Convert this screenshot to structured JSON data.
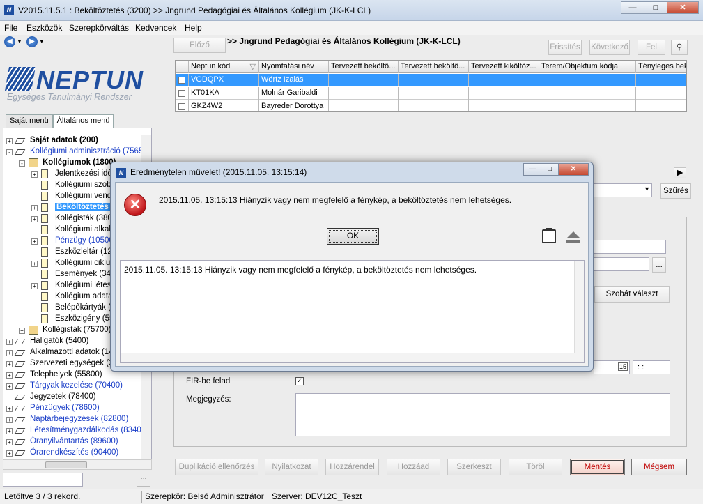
{
  "window": {
    "title": "V2015.11.5.1 : Beköltöztetés (3200)  >> Jngrund Pedagógiai és Általános Kollégium (JK-K-LCL)",
    "app_icon": "N"
  },
  "menu": [
    "File",
    "Eszközök",
    "Szerepkörváltás",
    "Kedvencek",
    "Help"
  ],
  "logo": {
    "name": "NEPTUN",
    "subtitle": "Egységes Tanulmányi Rendszer"
  },
  "sidebar_tabs": [
    "Saját menü",
    "Általános menü"
  ],
  "tree": [
    {
      "label": "Saját adatok (200)",
      "indent": 0,
      "icon": "diamond",
      "style": "bold",
      "exp": "+"
    },
    {
      "label": "Kollégiumi adminisztráció (75650)",
      "indent": 0,
      "icon": "diamond",
      "style": "blue",
      "exp": "-"
    },
    {
      "label": "Kollégiumok (1800)",
      "indent": 1,
      "icon": "house",
      "style": "bold",
      "exp": "-"
    },
    {
      "label": "Jelentkezési idő",
      "indent": 2,
      "icon": "doc",
      "style": "",
      "exp": "+"
    },
    {
      "label": "Kollégiumi szoba",
      "indent": 2,
      "icon": "doc",
      "style": "",
      "exp": ""
    },
    {
      "label": "Kollégiumi vendé",
      "indent": 2,
      "icon": "doc",
      "style": "",
      "exp": ""
    },
    {
      "label": "Beköltöztetés",
      "indent": 2,
      "icon": "doc",
      "style": "sel",
      "exp": "+"
    },
    {
      "label": "Kollégisták (380",
      "indent": 2,
      "icon": "doc",
      "style": "",
      "exp": "+"
    },
    {
      "label": "Kollégiumi alkalm",
      "indent": 2,
      "icon": "doc",
      "style": "",
      "exp": ""
    },
    {
      "label": "Pénzügy (10500",
      "indent": 2,
      "icon": "doc",
      "style": "blue",
      "exp": "+"
    },
    {
      "label": "Eszközleltár (12",
      "indent": 2,
      "icon": "doc",
      "style": "",
      "exp": ""
    },
    {
      "label": "Kollégiumi ciklus",
      "indent": 2,
      "icon": "doc",
      "style": "",
      "exp": "+"
    },
    {
      "label": "Események (345",
      "indent": 2,
      "icon": "doc",
      "style": "",
      "exp": ""
    },
    {
      "label": "Kollégiumi létesí",
      "indent": 2,
      "icon": "doc",
      "style": "",
      "exp": "+"
    },
    {
      "label": "Kollégium adata",
      "indent": 2,
      "icon": "doc",
      "style": "",
      "exp": ""
    },
    {
      "label": "Belépőkártyák (",
      "indent": 2,
      "icon": "doc",
      "style": "",
      "exp": ""
    },
    {
      "label": "Eszközigény (55",
      "indent": 2,
      "icon": "doc",
      "style": "",
      "exp": ""
    },
    {
      "label": "Kollégisták (75700)",
      "indent": 1,
      "icon": "house",
      "style": "",
      "exp": "+"
    },
    {
      "label": "Hallgatók (5400)",
      "indent": 0,
      "icon": "diamond",
      "style": "",
      "exp": "+"
    },
    {
      "label": "Alkalmazotti adatok (148",
      "indent": 0,
      "icon": "diamond",
      "style": "",
      "exp": "+"
    },
    {
      "label": "Szervezeti egységek (28",
      "indent": 0,
      "icon": "diamond",
      "style": "",
      "exp": "+"
    },
    {
      "label": "Telephelyek (55800)",
      "indent": 0,
      "icon": "diamond",
      "style": "",
      "exp": "+"
    },
    {
      "label": "Tárgyak kezelése (70400)",
      "indent": 0,
      "icon": "diamond",
      "style": "blue",
      "exp": "+"
    },
    {
      "label": "Jegyzetek (78400)",
      "indent": 0,
      "icon": "diamond",
      "style": "",
      "exp": ""
    },
    {
      "label": "Pénzügyek (78600)",
      "indent": 0,
      "icon": "diamond",
      "style": "blue",
      "exp": "+"
    },
    {
      "label": "Naptárbejegyzések (82800)",
      "indent": 0,
      "icon": "diamond",
      "style": "blue",
      "exp": "+"
    },
    {
      "label": "Létesítménygazdálkodás (83400)",
      "indent": 0,
      "icon": "diamond",
      "style": "blue",
      "exp": "+"
    },
    {
      "label": "Óranyilvántartás (89600)",
      "indent": 0,
      "icon": "diamond",
      "style": "blue",
      "exp": "+"
    },
    {
      "label": "Órarendkészítés (90400)",
      "indent": 0,
      "icon": "diamond",
      "style": "blue",
      "exp": "+"
    }
  ],
  "toolbar": {
    "prev": "Előző",
    "breadcrumb": ">> Jngrund Pedagógiai és Általános Kollégium (JK-K-LCL)",
    "refresh": "Frissítés",
    "next": "Következő",
    "up": "Fel"
  },
  "grid": {
    "columns": [
      "",
      "Neptun kód",
      "Nyomtatási név",
      "Tervezett beköltö...",
      "Tervezett beköltö...",
      "Tervezett kiköltöz...",
      "Terem/Objektum kódja",
      "Tényleges bek"
    ],
    "rows": [
      {
        "code": "VGDQPX",
        "name": "Wörtz Izaiás",
        "selected": true
      },
      {
        "code": "KT01KA",
        "name": "Molnár Garibaldi",
        "selected": false
      },
      {
        "code": "GKZ4W2",
        "name": "Bayreder Dorottya",
        "selected": false
      }
    ]
  },
  "filter_button": "Szűrés",
  "form": {
    "room_button": "Szobát választ",
    "ellipsis": "...",
    "fir_label": "FIR-be felad",
    "fir_checked": true,
    "note_label": "Megjegyzés:",
    "time_placeholder": ": :",
    "calendar_label": "15"
  },
  "bottom_buttons": [
    "Duplikáció ellenőrzés",
    "Nyilatkozat",
    "Hozzárendel",
    "Hozzáad",
    "Szerkeszt",
    "Töröl",
    "Mentés",
    "Mégsem"
  ],
  "status": {
    "records": "Letöltve 3 / 3 rekord.",
    "role": "Szerepkör: Belső Adminisztrátor",
    "server": "Szerver: DEV12C_Teszt"
  },
  "dialog": {
    "title": "Eredménytelen művelet! (2015.11.05. 13:15:14)",
    "message": "2015.11.05. 13:15:13   Hiányzik vagy nem megfelelő a fénykép, a beköltöztetés nem lehetséges.",
    "ok": "OK",
    "detail": "2015.11.05. 13:15:13   Hiányzik vagy nem megfelelő a fénykép, a beköltöztetés nem lehetséges."
  }
}
